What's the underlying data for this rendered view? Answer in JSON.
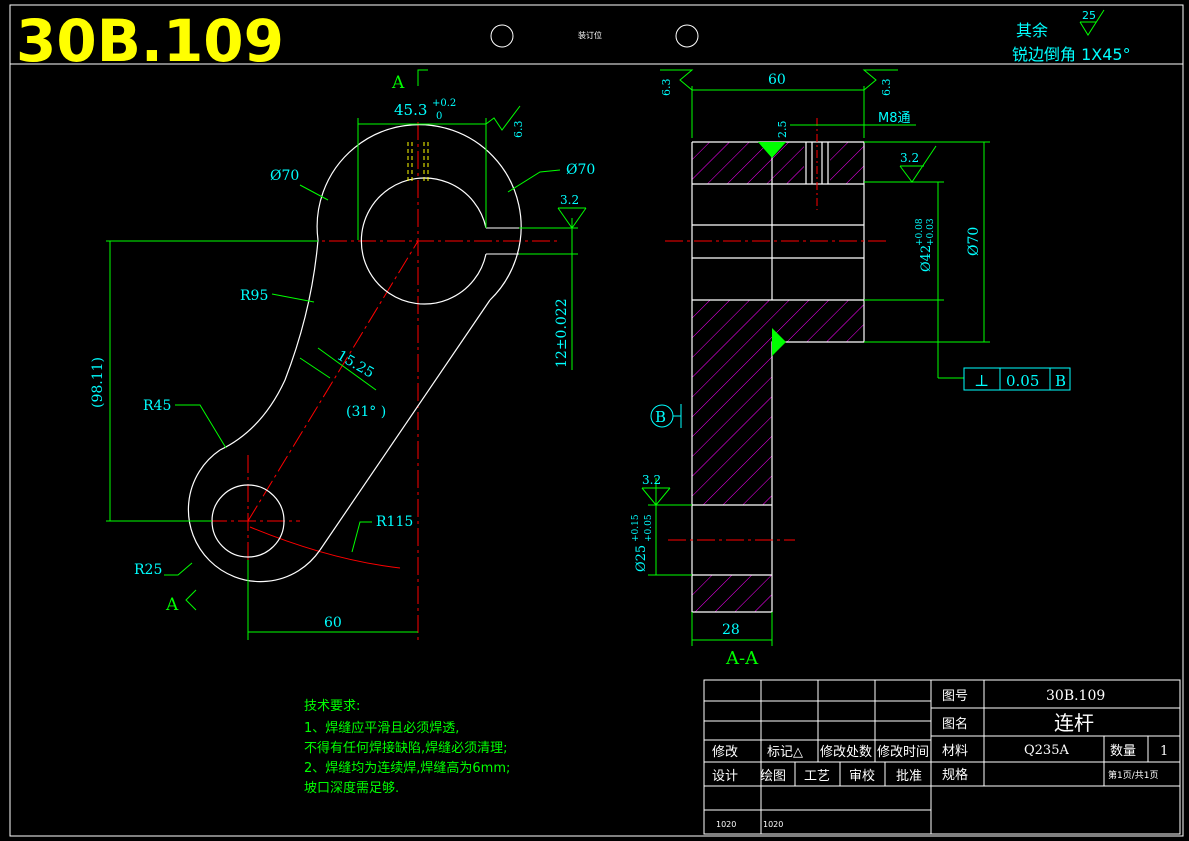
{
  "header": {
    "drawing_code": "30B.109",
    "binding_label": "装订位",
    "surface_note": "其余",
    "surface_note_value": "25",
    "chamfer_note": "锐边倒角 1X45°"
  },
  "colors": {
    "background": "#000000",
    "outline": "#ffffff",
    "dimension": "#00ffff",
    "extension": "#00ff00",
    "centerline": "#ff0000",
    "title": "#ffff00",
    "hatch": "#ff00ff"
  },
  "front_view": {
    "section_mark_top": "A",
    "section_mark_bottom": "A",
    "dim_bore_width": "45.3",
    "dim_bore_width_tol_upper": "+0.2",
    "dim_bore_width_tol_lower": "0",
    "dim_left_dia": "Ø70",
    "dim_right_dia": "Ø70",
    "dim_r95": "R95",
    "dim_r45": "R45",
    "dim_r25": "R25",
    "dim_r115": "R115",
    "dim_15_25": "15.25",
    "dim_angle": "(31° )",
    "dim_98_11": "(98.11)",
    "dim_12": "12±0.022",
    "dim_60_bottom": "60",
    "rough_6_3": "6.3",
    "rough_3_2": "3.2"
  },
  "section_view": {
    "title": "A-A",
    "dim_60_top": "60",
    "rough_left": "6.3",
    "rough_right": "6.3",
    "dim_2_5": "2.5",
    "thread": "M8通",
    "rough_3_2_top": "3.2",
    "dim_dia42": "Ø42",
    "dim_dia42_tol_upper": "+0.08",
    "dim_dia42_tol_lower": "+0.03",
    "dim_dia70": "Ø70",
    "tolerance_symbol": "⊥",
    "tolerance_value": "0.05",
    "tolerance_datum": "B",
    "datum_label": "B",
    "rough_3_2_bottom": "3.2",
    "dim_dia25": "Ø25",
    "dim_dia25_tol_upper": "+0.15",
    "dim_dia25_tol_lower": "+0.05",
    "dim_28": "28"
  },
  "tech_requirements": {
    "heading": "技术要求:",
    "lines": [
      "1、焊缝应平滑且必须焊透,",
      "不得有任何焊接缺陷,焊缝必须清理;",
      "2、焊缝均为连续焊,焊缝高为6mm;",
      "坡口深度需足够."
    ]
  },
  "title_block": {
    "revision_headers": [
      "修改",
      "标记△",
      "修改处数",
      "修改时间"
    ],
    "sign_headers": [
      "设计",
      "绘图",
      "工艺",
      "审校",
      "批准"
    ],
    "sign_dates": [
      "1020",
      "1020"
    ],
    "drawing_no_label": "图号",
    "drawing_no": "30B.109",
    "name_label": "图名",
    "name": "连杆",
    "material_label": "材料",
    "material": "Q235A",
    "qty_label": "数量",
    "qty": "1",
    "spec_label": "规格",
    "page": "第1页/共1页"
  }
}
